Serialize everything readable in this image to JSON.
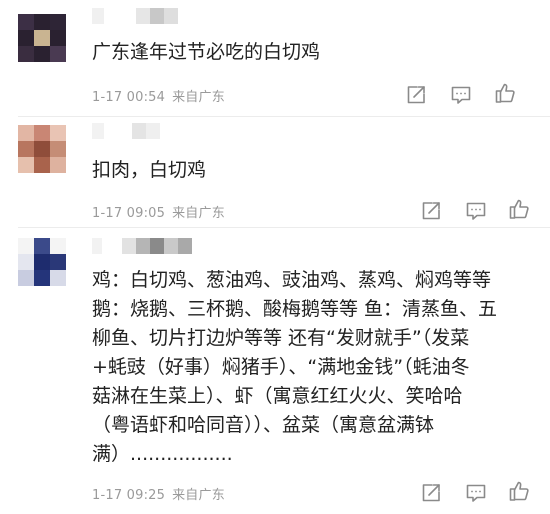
{
  "comments": [
    {
      "text": "广东逢年过节必吃的白切鸡",
      "time": "1-17 00:54",
      "location": "来自广东",
      "like_count": ""
    },
    {
      "text": "扣肉，白切鸡",
      "time": "1-17 09:05",
      "location": "来自广东",
      "like_count": ""
    },
    {
      "text": "鸡：白切鸡、葱油鸡、豉油鸡、蒸鸡、焖鸡等等\n鹅：烧鹅、三杯鹅、酸梅鹅等等 鱼：清蒸鱼、五\n柳鱼、切片打边炉等等 还有“发财就手”（发菜\n+蚝豉（好事）焖猪手）、“满地金钱”（蚝油冬\n菇淋在生菜上）、虾（寓意红红火火、笑哈哈\n（粤语虾和哈同音））、盆菜（寓意盆满钵\n满）.................",
      "time": "1-17 09:25",
      "location": "来自广东",
      "like_count": ""
    }
  ],
  "icons": {
    "share": "share-icon",
    "comment": "comment-icon",
    "like": "thumbs-up-icon"
  },
  "colors": {
    "text": "#222222",
    "meta": "#9a9a9a",
    "icon": "#8a8a8a",
    "divider": "#ececec"
  }
}
